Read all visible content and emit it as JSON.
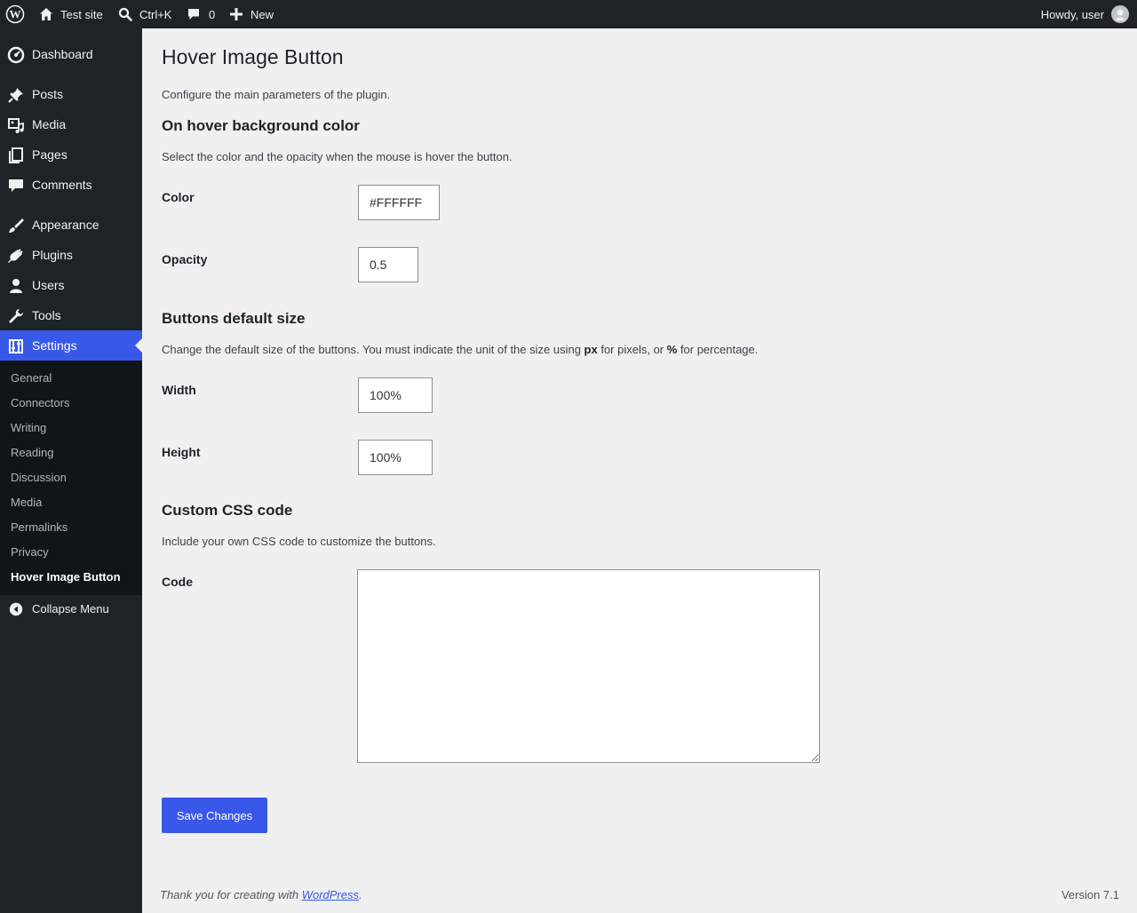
{
  "admin_bar": {
    "logo_icon": "wordpress-logo-icon",
    "site_name": "Test site",
    "search_shortcut": "Ctrl+K",
    "comments_count": "0",
    "new_label": "New",
    "greeting": "Howdy, user"
  },
  "sidebar": {
    "items": [
      {
        "label": "Dashboard",
        "icon": "dashboard-icon"
      },
      {
        "label": "Posts",
        "icon": "pin-icon"
      },
      {
        "label": "Media",
        "icon": "media-icon"
      },
      {
        "label": "Pages",
        "icon": "pages-icon"
      },
      {
        "label": "Comments",
        "icon": "comment-icon"
      },
      {
        "label": "Appearance",
        "icon": "brush-icon"
      },
      {
        "label": "Plugins",
        "icon": "plug-icon"
      },
      {
        "label": "Users",
        "icon": "user-icon"
      },
      {
        "label": "Tools",
        "icon": "wrench-icon"
      },
      {
        "label": "Settings",
        "icon": "settings-sliders-icon"
      }
    ],
    "submenu": [
      "General",
      "Connectors",
      "Writing",
      "Reading",
      "Discussion",
      "Media",
      "Permalinks",
      "Privacy",
      "Hover Image Button"
    ],
    "collapse_label": "Collapse Menu"
  },
  "page": {
    "title": "Hover Image Button",
    "intro": "Configure the main parameters of the plugin.",
    "sections": {
      "hover": {
        "title": "On hover background color",
        "description": "Select the color and the opacity when the mouse is hover the button.",
        "color_label": "Color",
        "color_value": "#FFFFFF",
        "opacity_label": "Opacity",
        "opacity_value": "0.5"
      },
      "size": {
        "title": "Buttons default size",
        "description_1": "Change the default size of the buttons. You must indicate the unit of the size using ",
        "unit_px": "px",
        "description_2": " for pixels, or ",
        "unit_percent": "%",
        "description_3": " for percentage.",
        "width_label": "Width",
        "width_value": "100%",
        "height_label": "Height",
        "height_value": "100%"
      },
      "css": {
        "title": "Custom CSS code",
        "description": "Include your own CSS code to customize the buttons.",
        "code_label": "Code",
        "code_value": ""
      }
    },
    "save_label": "Save Changes"
  },
  "footer": {
    "thanks_prefix": "Thank you for creating with ",
    "thanks_link": "WordPress",
    "thanks_suffix": ".",
    "version": "Version 7.1"
  },
  "colors": {
    "accent": "#3858e9",
    "admin_bar_bg": "#1d2327",
    "submenu_bg": "#101517",
    "page_bg": "#f0f0f1"
  }
}
